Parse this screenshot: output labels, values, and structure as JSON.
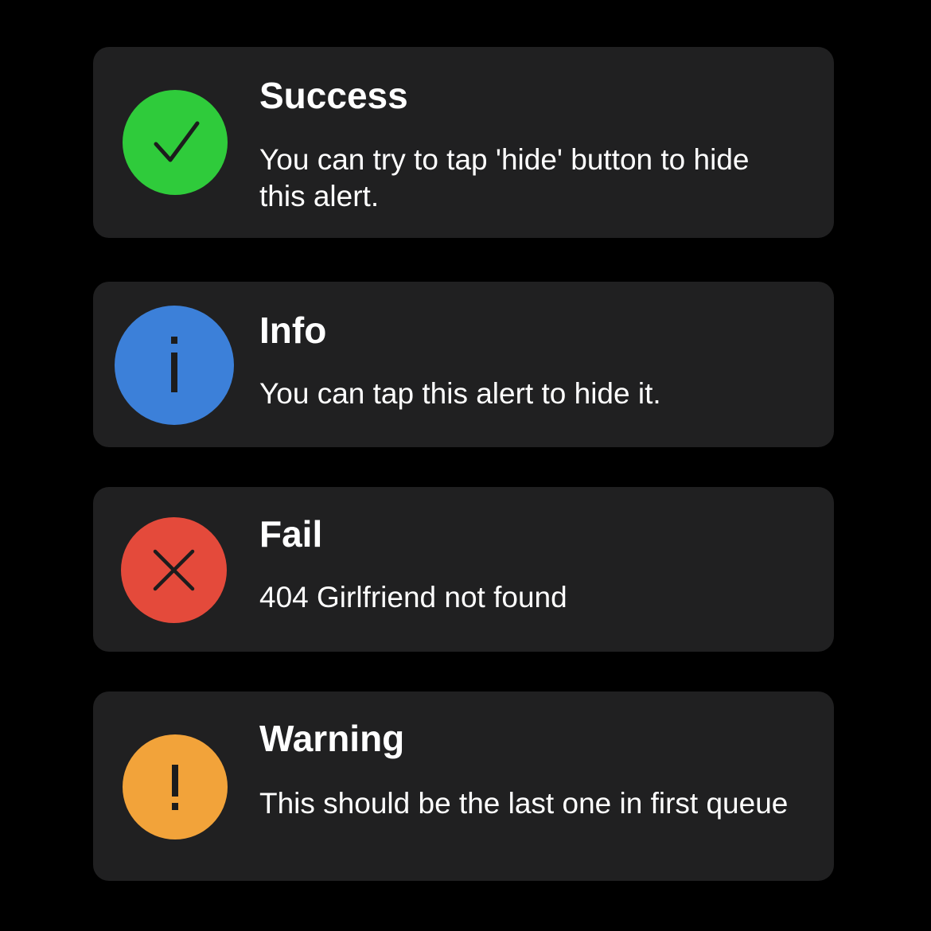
{
  "alerts": [
    {
      "kind": "success",
      "title": "Success",
      "message": "You can try to tap 'hide' button to hide this alert.",
      "icon": "checkmark-icon",
      "color": "#2fcb3b"
    },
    {
      "kind": "info",
      "title": "Info",
      "message": "You can tap this alert to hide it.",
      "icon": "info-icon",
      "color": "#3c80d9"
    },
    {
      "kind": "fail",
      "title": "Fail",
      "message": "404 Girlfriend not found",
      "icon": "cross-icon",
      "color": "#e44a3b"
    },
    {
      "kind": "warning",
      "title": "Warning",
      "message": "This should be the last one in first queue",
      "icon": "exclamation-icon",
      "color": "#f2a33a"
    }
  ],
  "theme": {
    "background": "#000000",
    "card_background": "#202021",
    "text_color": "#ffffff",
    "icon_stroke": "#1c1c1c"
  }
}
